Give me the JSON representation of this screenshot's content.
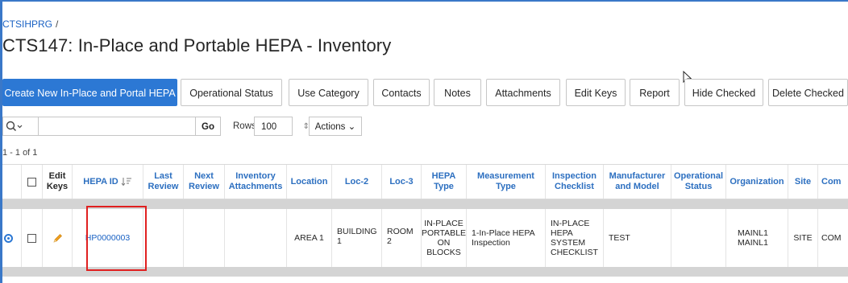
{
  "breadcrumb": {
    "parent": "CTSIHPRG",
    "separator": "/"
  },
  "page_title": "CTS147: In-Place and Portable HEPA - Inventory",
  "toolbar": {
    "buttons": [
      "Create New In-Place and Portal HEPA",
      "Operational Status",
      "Use Category",
      "Contacts",
      "Notes",
      "Attachments",
      "Edit Keys",
      "Report",
      "Hide Checked",
      "Delete Checked"
    ]
  },
  "search": {
    "go_label": "Go",
    "rows_label": "Rows",
    "rows_value": "100",
    "actions_label": "Actions"
  },
  "pagination": {
    "count_text": "1 - 1 of 1"
  },
  "table": {
    "headers": {
      "edit_keys": "Edit Keys",
      "hepa_id": "HEPA ID",
      "last_review": "Last Review",
      "next_review": "Next Review",
      "inventory_attachments": "Inventory Attachments",
      "location": "Location",
      "loc2": "Loc-2",
      "loc3": "Loc-3",
      "hepa_type": "HEPA Type",
      "measurement_type": "Measurement Type",
      "inspection_checklist": "Inspection Checklist",
      "manufacturer_model": "Manufacturer and Model",
      "operational_status": "Operational Status",
      "organization": "Organization",
      "site": "Site",
      "com": "Com"
    },
    "row": {
      "hepa_id": "HP0000003",
      "location": "AREA 1",
      "loc2": "BUILDING 1",
      "loc3": "ROOM 2",
      "hepa_type": "IN-PLACE PORTABLE ON BLOCKS",
      "measurement_type": "1-In-Place HEPA Inspection",
      "inspection_checklist": "IN-PLACE HEPA SYSTEM CHECKLIST",
      "manufacturer_model": "TEST",
      "operational_status": "",
      "organization": "MAINL1 MAINL1",
      "site": "SITE",
      "com": "COM"
    }
  },
  "colors": {
    "primary": "#2c78d4",
    "link": "#1a62c4",
    "highlight": "#e02020"
  },
  "icons": [
    "search-icon",
    "chevron-down-icon",
    "sort-descending-icon",
    "pencil-icon",
    "mouse-cursor-icon"
  ]
}
